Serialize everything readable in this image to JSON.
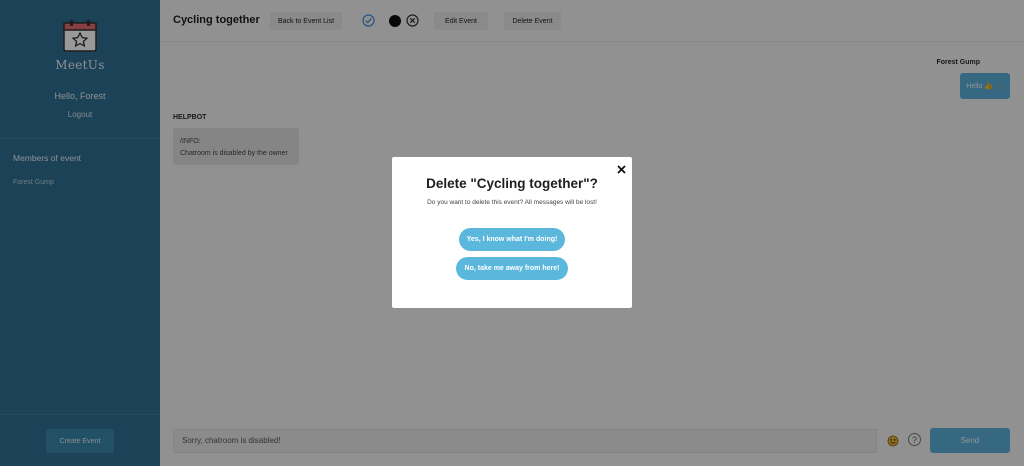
{
  "sidebar": {
    "brand": "MeetUs",
    "greeting": "Hello, Forest",
    "logout": "Logout",
    "members_title": "Members of event",
    "members": [
      "Forest Gump"
    ],
    "create_event": "Create Event"
  },
  "header": {
    "title": "Cycling together",
    "back_label": "Back to Event List",
    "edit_label": "Edit Event",
    "delete_label": "Delete Event",
    "status_icons": [
      "check-circle-icon",
      "black-dot-icon",
      "x-circle-icon"
    ]
  },
  "chat": {
    "messages": [
      {
        "sender": "Forest Gump",
        "text": "Hello",
        "emojis": [
          "thumbs-up-icon",
          "bike-icon"
        ]
      },
      {
        "sender": "HELPBOT",
        "line1": "/INFO:",
        "line2": "Chatroom is disabled by the owner"
      }
    ],
    "input_placeholder": "Sorry, chatroom is disabled!",
    "send_label": "Send",
    "help_glyph": "?"
  },
  "modal": {
    "title": "Delete \"Cycling together\"?",
    "text": "Do you want to delete this event? All messages will be lost!",
    "confirm_label": "Yes, I know what I'm doing!",
    "cancel_label": "No, take me away from here!"
  },
  "colors": {
    "sidebar": "#2e6f92",
    "accent": "#5bb8dc",
    "overlay": "rgba(0,0,0,0.4)"
  }
}
